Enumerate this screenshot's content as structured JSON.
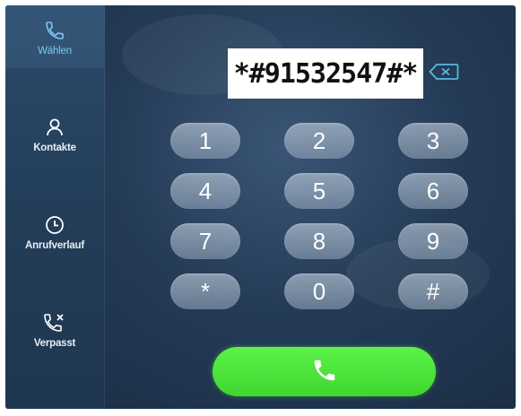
{
  "sidebar": {
    "items": [
      {
        "label": "Wählen",
        "icon": "phone-icon",
        "active": true
      },
      {
        "label": "Kontakte",
        "icon": "person-icon",
        "active": false
      },
      {
        "label": "Anrufverlauf",
        "icon": "clock-icon",
        "active": false
      },
      {
        "label": "Verpasst",
        "icon": "missed-call-icon",
        "active": false
      }
    ]
  },
  "dialer": {
    "number": "*#91532547#*",
    "keys": [
      "1",
      "2",
      "3",
      "4",
      "5",
      "6",
      "7",
      "8",
      "9",
      "*",
      "0",
      "#"
    ],
    "call_icon": "phone-icon",
    "backspace_icon": "backspace-icon"
  },
  "colors": {
    "accent_active": "#7cc7f2",
    "call_green": "#4ae838",
    "backspace": "#5ab8e0"
  }
}
